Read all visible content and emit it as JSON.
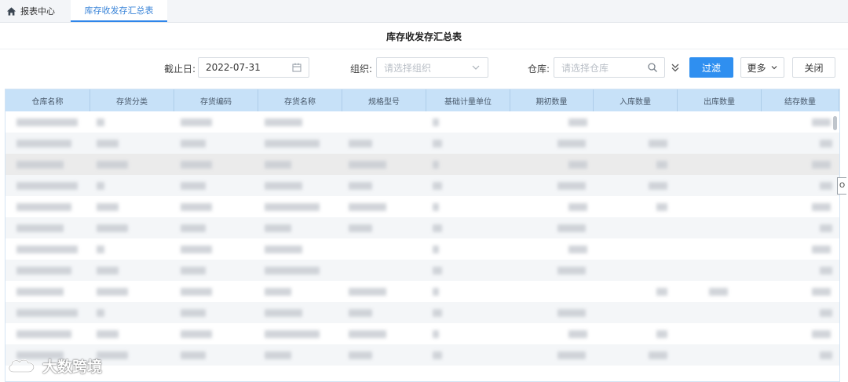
{
  "tabs": [
    {
      "label": "报表中心",
      "icon": "home-icon"
    },
    {
      "label": "库存收发存汇总表",
      "active": true
    }
  ],
  "page_title": "库存收发存汇总表",
  "filters": {
    "deadline_label": "截止日:",
    "deadline_value": "2022-07-31",
    "org_label": "组织:",
    "org_placeholder": "请选择组织",
    "warehouse_label": "仓库:",
    "warehouse_placeholder": "请选择仓库"
  },
  "buttons": {
    "filter": "过滤",
    "more": "更多",
    "close": "关闭"
  },
  "table": {
    "columns": [
      "仓库名称",
      "存货分类",
      "存货编码",
      "存货名称",
      "规格型号",
      "基础计量单位",
      "期初数量",
      "入库数量",
      "出库数量",
      "结存数量"
    ],
    "row_count": 12,
    "note": "cell values are pixelated in the screenshot"
  },
  "edge_control": "O",
  "watermark": "大数跨境",
  "colors": {
    "primary": "#2f8ff0",
    "header_bg": "#c7e1f8",
    "active_tab": "#3a84d8"
  }
}
